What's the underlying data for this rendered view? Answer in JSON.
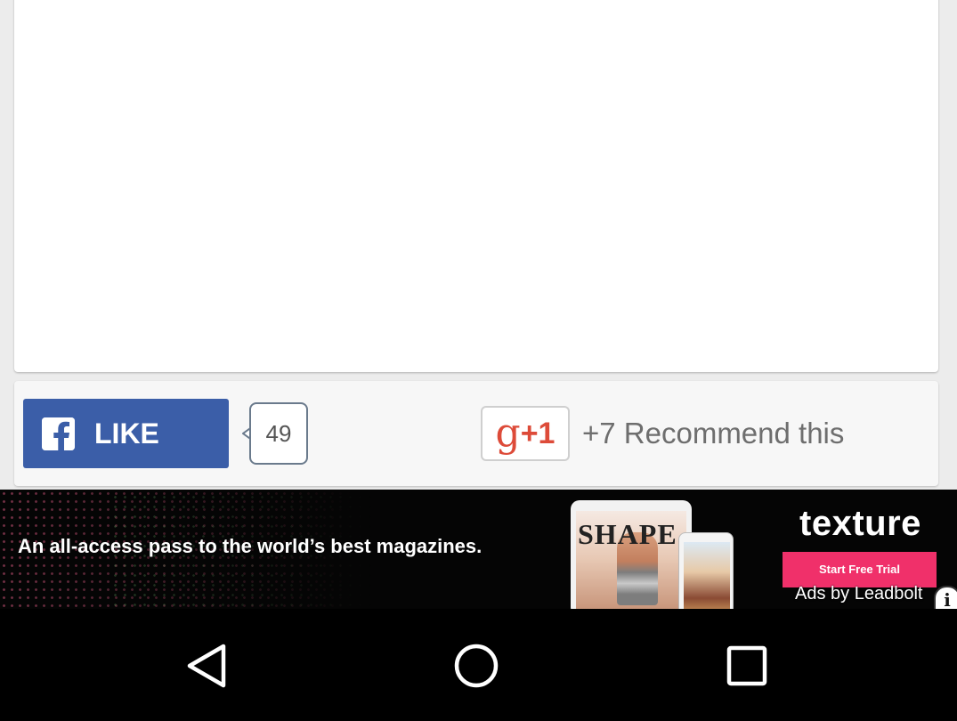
{
  "social": {
    "like_label": "LIKE",
    "like_count": "49",
    "gplus_g": "g",
    "gplus_plus_one": "+1",
    "recommend_text": "+7 Recommend this"
  },
  "ad": {
    "headline": "An all-access pass to the world’s best magazines.",
    "magazine_title": "SHAPE",
    "brand": "texture",
    "cta": "Start Free Trial",
    "attribution": "Ads by Leadbolt",
    "info_glyph": "i"
  },
  "colors": {
    "facebook_blue": "#3b5ea8",
    "gplus_red": "#dd4b39",
    "cta_pink": "#f0306a"
  },
  "icons": {
    "facebook": "facebook-f-icon",
    "back": "triangle-back-icon",
    "home": "circle-home-icon",
    "recents": "square-recents-icon"
  }
}
